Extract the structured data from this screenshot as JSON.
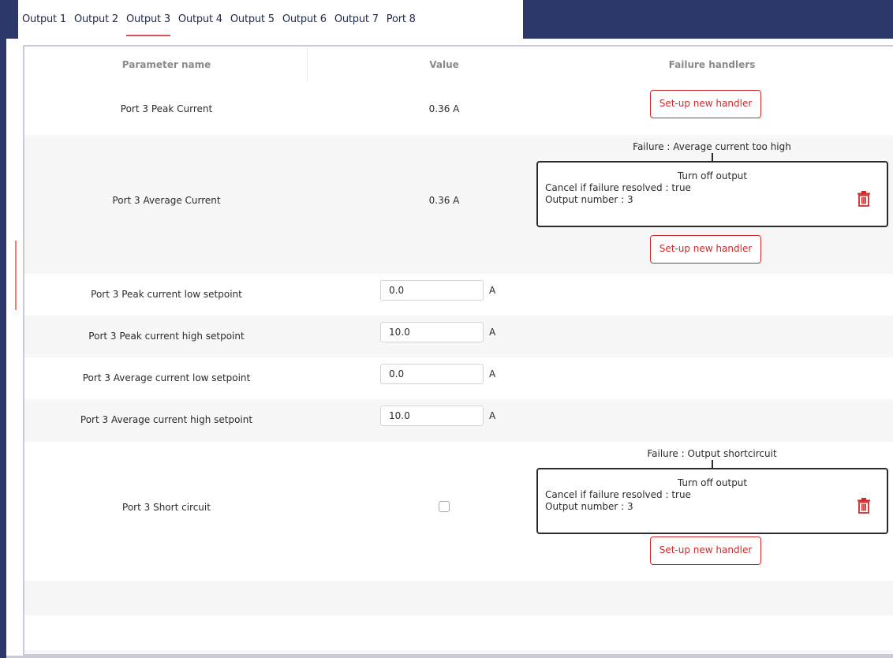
{
  "tabs": [
    "Output 1",
    "Output 2",
    "Output 3",
    "Output 4",
    "Output 5",
    "Output 6",
    "Output 7",
    "Port 8"
  ],
  "active_tab": "Output 3",
  "table": {
    "headers": {
      "name": "Parameter name",
      "value": "Value",
      "handlers": "Failure handlers"
    },
    "peak_current": {
      "name": "Port 3 Peak Current",
      "value": "0.36 A",
      "add_button": "Set-up new handler"
    },
    "average_current": {
      "name": "Port 3 Average Current",
      "value": "0.36 A",
      "failure": "Failure : Average current too high",
      "handler": {
        "action": "Turn off output",
        "cancel": "Cancel if failure resolved : true",
        "output": "Output number : 3"
      },
      "add_button": "Set-up new handler"
    },
    "peak_low": {
      "name": "Port 3 Peak current low setpoint",
      "value": "0.0",
      "unit": "A"
    },
    "peak_high": {
      "name": "Port 3 Peak current high setpoint",
      "value": "10.0",
      "unit": "A"
    },
    "avg_low": {
      "name": "Port 3 Average current low setpoint",
      "value": "0.0",
      "unit": "A"
    },
    "avg_high": {
      "name": "Port 3 Average current high setpoint",
      "value": "10.0",
      "unit": "A"
    },
    "short_circuit": {
      "name": "Port 3 Short circuit",
      "checked": false,
      "failure": "Failure : Output shortcircuit",
      "handler": {
        "action": "Turn off output",
        "cancel": "Cancel if failure resolved : true",
        "output": "Output number : 3"
      },
      "add_button": "Set-up new handler"
    }
  },
  "colors": {
    "nav_bg": "#2c3869",
    "accent_red": "#cc2a2a",
    "tab_underline": "#d9534f",
    "row_alt": "#f7f7f8"
  },
  "icons": {
    "delete": "trash-icon"
  }
}
